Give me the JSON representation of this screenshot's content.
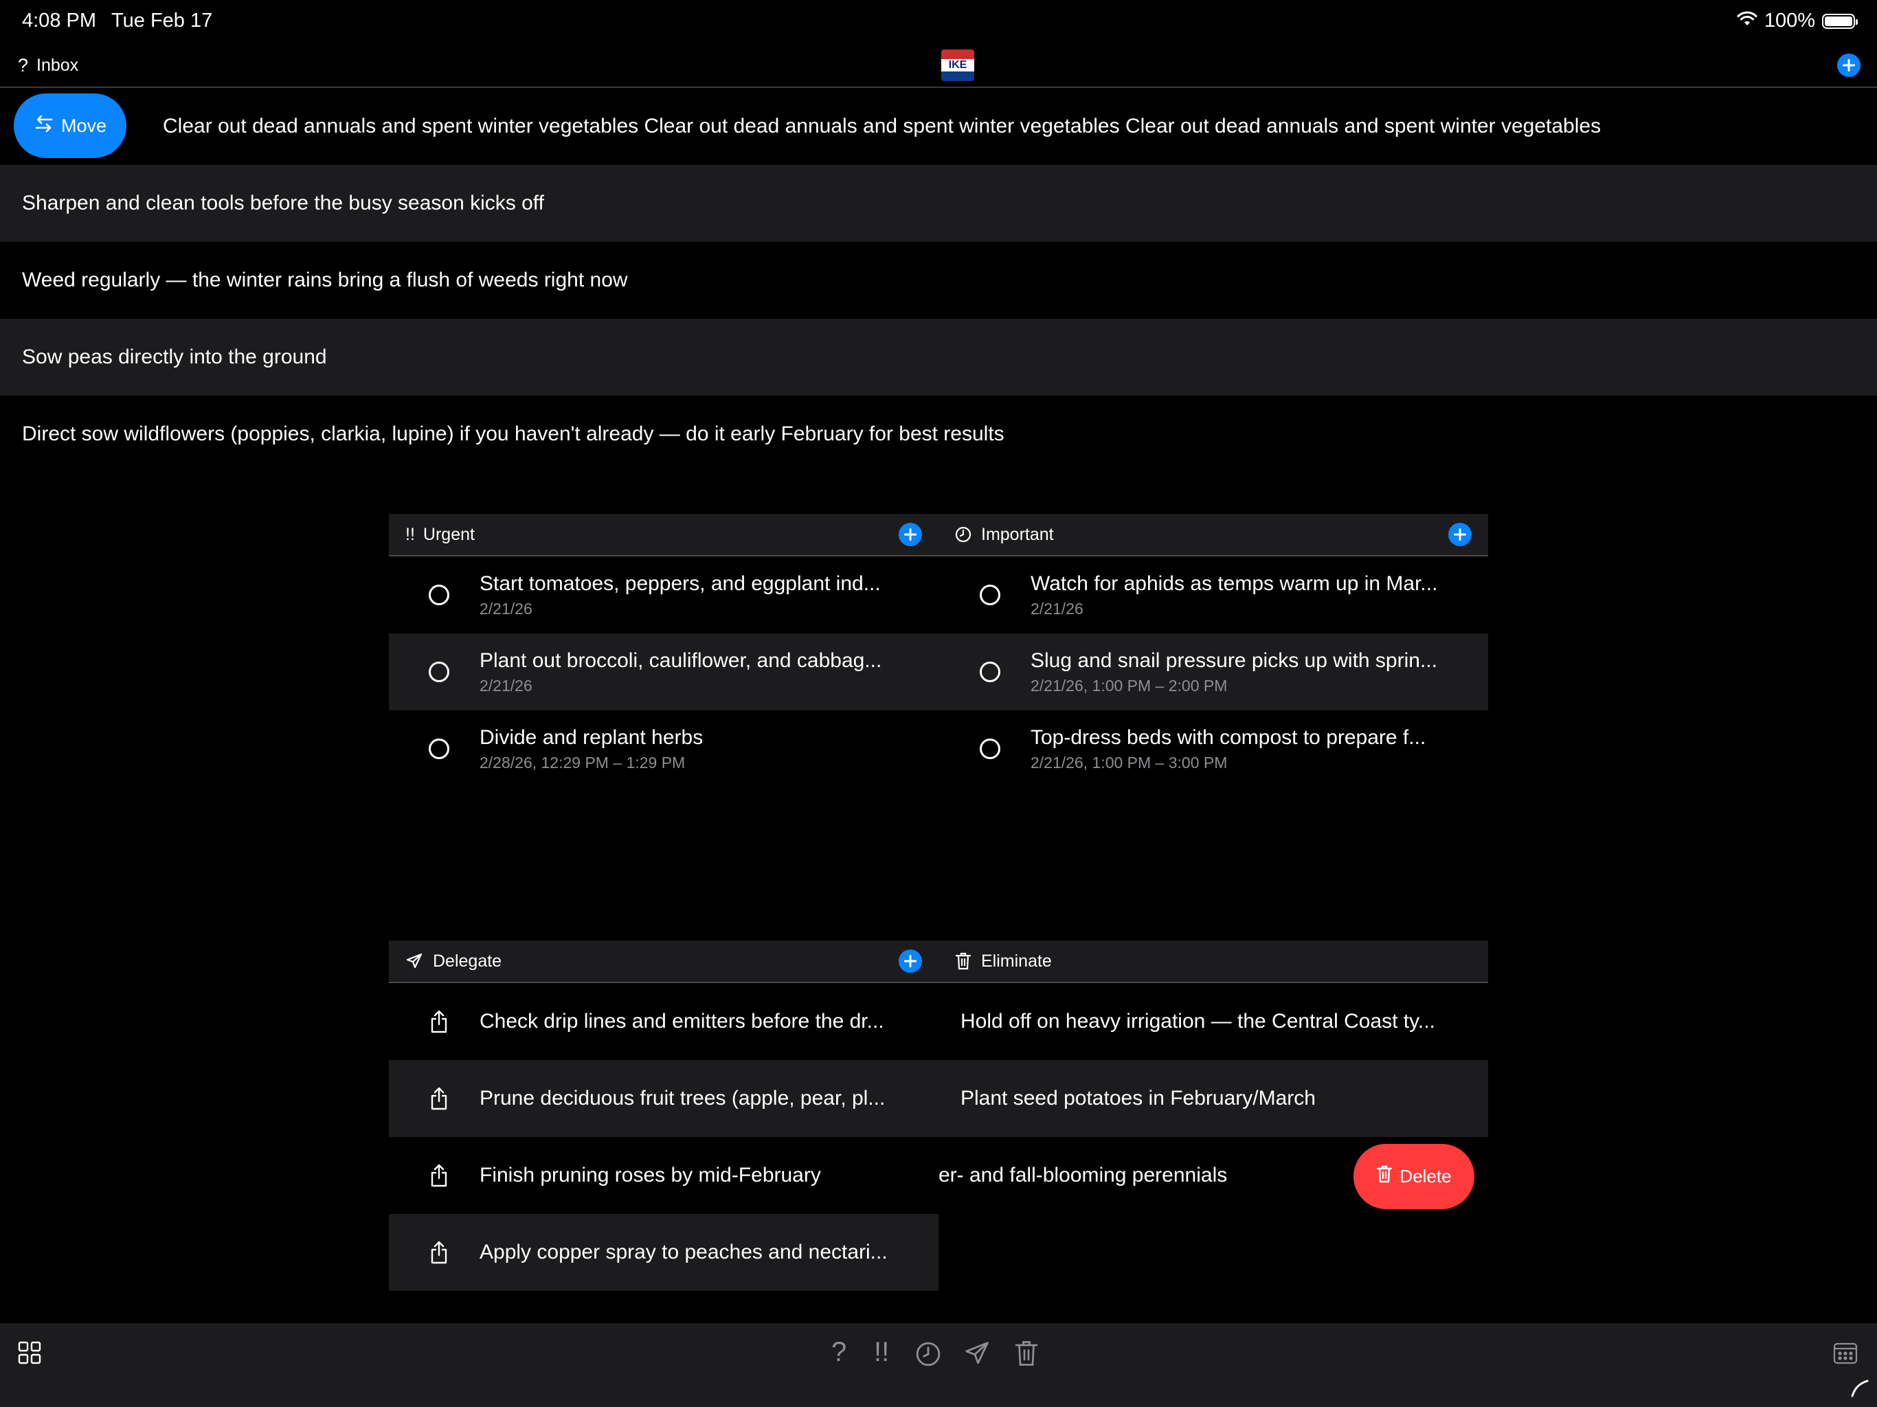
{
  "status_bar": {
    "time": "4:08 PM",
    "date": "Tue Feb 17",
    "battery": "100%"
  },
  "nav": {
    "back_label": "Inbox",
    "help_glyph": "?"
  },
  "inbox": {
    "move_label": "Move",
    "items": [
      "Clear out dead annuals and spent winter vegetables Clear out dead annuals and spent winter vegetables Clear out dead annuals and spent winter vegetables",
      "Sharpen and clean tools before the busy season kicks off",
      "Weed regularly — the winter rains bring a flush of weeds right now",
      "Sow peas directly into the ground",
      "Direct sow wildflowers (poppies, clarkia, lupine) if you haven't already — do it early February for best results"
    ]
  },
  "urgent": {
    "title": "Urgent",
    "icon_glyph": "!!",
    "tasks": [
      {
        "title": "Start tomatoes, peppers, and eggplant ind...",
        "date": "2/21/26"
      },
      {
        "title": "Plant out broccoli, cauliflower, and cabbag...",
        "date": "2/21/26"
      },
      {
        "title": "Divide and replant herbs",
        "date": "2/28/26, 12:29 PM – 1:29 PM"
      }
    ]
  },
  "important": {
    "title": "Important",
    "tasks": [
      {
        "title": "Watch for aphids as temps warm up in Mar...",
        "date": "2/21/26"
      },
      {
        "title": "Slug and snail pressure picks up with sprin...",
        "date": "2/21/26, 1:00 PM – 2:00 PM"
      },
      {
        "title": "Top-dress beds with compost to prepare f...",
        "date": "2/21/26, 1:00 PM – 3:00 PM"
      }
    ]
  },
  "delegate": {
    "title": "Delegate",
    "tasks": [
      "Check drip lines and emitters before the dr...",
      "Prune deciduous fruit trees (apple, pear, pl...",
      "Finish pruning roses by mid-February",
      "Apply copper spray to peaches and nectari..."
    ]
  },
  "eliminate": {
    "title": "Eliminate",
    "tasks": [
      "Hold off on heavy irrigation — the Central Coast ty...",
      "Plant seed potatoes in February/March",
      "er- and fall-blooming perennials"
    ],
    "delete_label": "Delete"
  },
  "toolbar": {
    "inbox_glyph": "?",
    "urgent_glyph": "!!"
  },
  "colors": {
    "accent": "#0a84ff",
    "delete": "#ff3b3b",
    "row_alt": "#1c1c1e",
    "background": "#000000"
  }
}
